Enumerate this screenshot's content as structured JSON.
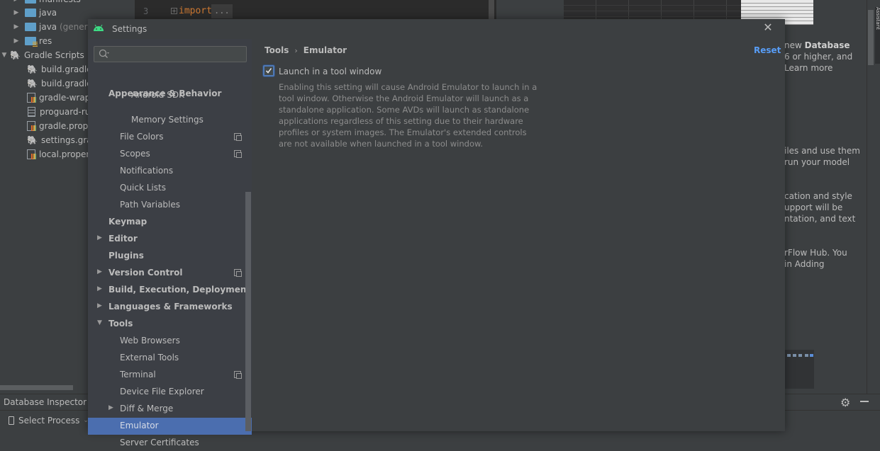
{
  "project_tree": {
    "items": [
      {
        "label": "manifests",
        "icon": "folder-icon",
        "expanded": false
      },
      {
        "label": "java",
        "icon": "folder-icon",
        "expanded": false
      },
      {
        "label": "java",
        "suffix": "(generat",
        "icon": "generated-folder-icon",
        "expanded": false
      },
      {
        "label": "res",
        "icon": "resource-folder-icon",
        "expanded": false
      },
      {
        "label": "Gradle Scripts",
        "icon": "gradle-icon",
        "expanded": true
      },
      {
        "label": "build.gradle (",
        "icon": "gradle-icon"
      },
      {
        "label": "build.gradle (",
        "icon": "gradle-icon"
      },
      {
        "label": "gradle-wrapp",
        "icon": "properties-icon"
      },
      {
        "label": "proguard-rul",
        "icon": "text-file-icon"
      },
      {
        "label": "gradle.proper",
        "icon": "properties-icon"
      },
      {
        "label": "settings.grad",
        "icon": "gradle-icon"
      },
      {
        "label": "local.properti",
        "icon": "properties-icon"
      }
    ]
  },
  "editor": {
    "line_number": "3",
    "keyword": "import",
    "folded": "..."
  },
  "background_panel": {
    "lines": [
      {
        "pre": "new ",
        "bold": "Database",
        "post": ""
      },
      {
        "pre": "6 or higher, and",
        "bold": "",
        "post": ""
      },
      {
        "pre": "Learn more",
        "bold": "",
        "post": ""
      },
      {
        "pre": "iles and use them",
        "bold": "",
        "post": ""
      },
      {
        "pre": " run your model",
        "bold": "",
        "post": ""
      },
      {
        "pre": "cation and style",
        "bold": "",
        "post": ""
      },
      {
        "pre": "upport will be",
        "bold": "",
        "post": ""
      },
      {
        "pre": "ntation, and text",
        "bold": "",
        "post": ""
      },
      {
        "pre": "rFlow Hub. You",
        "bold": "",
        "post": ""
      },
      {
        "pre": " in Adding",
        "bold": "",
        "post": ""
      }
    ],
    "assistant_tab": "Assistant"
  },
  "bottom_bar": {
    "tool_window_title": "Database Inspector",
    "process_selector": "Select Process"
  },
  "dialog": {
    "title": "Settings",
    "search": {
      "value": "",
      "placeholder": ""
    },
    "nav": {
      "sticky_header": "Appearance & Behavior",
      "items": [
        {
          "label": "Android SDK",
          "level": 2,
          "partial": true
        },
        {
          "label": "Memory Settings",
          "level": 2
        },
        {
          "label": "File Colors",
          "level": 1,
          "project_icon": true
        },
        {
          "label": "Scopes",
          "level": 1,
          "project_icon": true
        },
        {
          "label": "Notifications",
          "level": 1
        },
        {
          "label": "Quick Lists",
          "level": 1
        },
        {
          "label": "Path Variables",
          "level": 1
        },
        {
          "label": "Keymap",
          "level": 0,
          "bold": true
        },
        {
          "label": "Editor",
          "level": 0,
          "bold": true,
          "arrow": "collapsed"
        },
        {
          "label": "Plugins",
          "level": 0,
          "bold": true
        },
        {
          "label": "Version Control",
          "level": 0,
          "bold": true,
          "arrow": "collapsed",
          "project_icon": true
        },
        {
          "label": "Build, Execution, Deployment",
          "level": 0,
          "bold": true,
          "arrow": "collapsed"
        },
        {
          "label": "Languages & Frameworks",
          "level": 0,
          "bold": true,
          "arrow": "collapsed"
        },
        {
          "label": "Tools",
          "level": 0,
          "bold": true,
          "arrow": "expanded"
        },
        {
          "label": "Web Browsers",
          "level": 1
        },
        {
          "label": "External Tools",
          "level": 1
        },
        {
          "label": "Terminal",
          "level": 1,
          "project_icon": true
        },
        {
          "label": "Device File Explorer",
          "level": 1
        },
        {
          "label": "Diff & Merge",
          "level": 1,
          "arrow": "collapsed"
        },
        {
          "label": "Emulator",
          "level": 1,
          "selected": true
        },
        {
          "label": "Server Certificates",
          "level": 1
        }
      ]
    },
    "content": {
      "breadcrumb": [
        "Tools",
        "Emulator"
      ],
      "reset_label": "Reset",
      "launch_in_tool_window": {
        "label": "Launch in a tool window",
        "checked": true,
        "description": "Enabling this setting will cause Android Emulator to launch in a tool window. Otherwise the Android Emulator will launch as a standalone application. Some AVDs will launch as standalone applications regardless of this setting due to their hardware profiles or system images. The Emulator's extended controls are not available when launched in a tool window."
      }
    }
  },
  "colors": {
    "accent": "#4b6eaf",
    "link": "#589df6",
    "android_green": "#3ddc84",
    "keyword": "#cc7832"
  }
}
